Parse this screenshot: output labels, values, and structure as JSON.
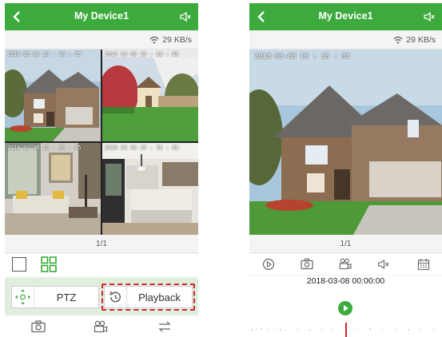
{
  "left_screen": {
    "header": {
      "title": "My Device1",
      "back_icon": "chevron-left-icon",
      "speaker_icon": "speaker-muted-icon"
    },
    "network": {
      "rate": "29 KB/s",
      "icon": "wifi-icon"
    },
    "cameras": [
      {
        "timestamp": "2018 03 08 10 : 36 : 05",
        "scene": "house-exterior"
      },
      {
        "timestamp": "2018 03 08 10 : 36 : 05",
        "scene": "backyard-shed"
      },
      {
        "timestamp": "2018 03 08 10 : 36 : 05",
        "scene": "living-room"
      },
      {
        "timestamp": "2018 03 08 10 : 36 : 05",
        "scene": "kitchen"
      }
    ],
    "page_indicator": "1/1",
    "layout_options": [
      "single-view-icon",
      "quad-view-icon"
    ],
    "controls": {
      "ptz_label": "PTZ",
      "playback_label": "Playback"
    },
    "bottom_bar": [
      "camera-snapshot-icon",
      "record-video-icon",
      "switch-icon"
    ],
    "accent": "#3daa3d",
    "highlight_color": "#d6252a"
  },
  "right_screen": {
    "header": {
      "title": "My Device1",
      "back_icon": "chevron-left-icon",
      "speaker_icon": "speaker-muted-icon"
    },
    "network": {
      "rate": "29 KB/s",
      "icon": "wifi-icon"
    },
    "video_timestamp": "2018-03-08 10 : 36 : 05",
    "page_indicator": "1/1",
    "tools": [
      "play-circle-icon",
      "camera-snapshot-icon",
      "record-video-icon",
      "speaker-muted-icon",
      "calendar-icon"
    ],
    "playback_datetime": "2018-03-08 00:00:00"
  }
}
